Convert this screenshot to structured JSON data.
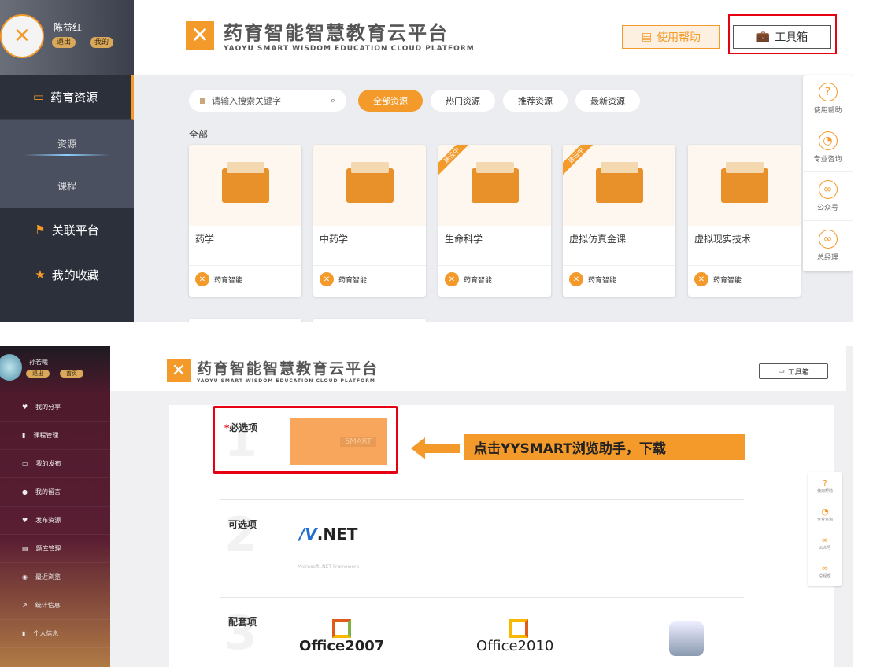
{
  "top": {
    "user": {
      "name": "陈益红",
      "logout": "退出",
      "mine": "我的"
    },
    "sidebar": [
      {
        "label": "药育资源"
      },
      {
        "label": "关联平台"
      },
      {
        "label": "我的收藏"
      }
    ],
    "sub": [
      "资源",
      "课程"
    ],
    "logo": {
      "title": "药育智能智慧教育云平台",
      "subtitle": "YAOYU SMART WISDOM EDUCATION CLOUD PLATFORM"
    },
    "help_btn": "使用帮助",
    "tool_btn": "工具箱",
    "search_placeholder": "请输入搜索关键字",
    "filters": [
      "全部资源",
      "热门资源",
      "推荐资源",
      "最新资源"
    ],
    "section": "全部",
    "cards": [
      {
        "name": "药学",
        "badge": ""
      },
      {
        "name": "中药学",
        "badge": ""
      },
      {
        "name": "生命科学",
        "badge": "建设中"
      },
      {
        "name": "虚拟仿真金课",
        "badge": "建设中"
      },
      {
        "name": "虚拟现实技术",
        "badge": ""
      }
    ],
    "card_owner": "药育智能",
    "float": [
      "使用帮助",
      "专业咨询",
      "公众号",
      "总经理"
    ]
  },
  "bottom": {
    "user": {
      "name": "孙若曦",
      "logout": "退出",
      "home": "首页"
    },
    "sidebar": [
      "我的分享",
      "课程管理",
      "我的发布",
      "我的留言",
      "发布资源",
      "题库管理",
      "最近浏览",
      "统计信息",
      "个人信息"
    ],
    "logo": {
      "title": "药育智能智慧教育云平台",
      "subtitle": "YAOYU SMART WISDOM EDUCATION CLOUD PLATFORM"
    },
    "tool_btn": "工具箱",
    "required": "必选项",
    "optional": "可选项",
    "bundled": "配套项",
    "smart_label": "SMART",
    "net_caption": "Microsoft .NET Framework",
    "net_logo": ".NET",
    "office2007": "Office2007",
    "office2010": "Office2010",
    "callout": "点击YYSMART浏览助手，下载",
    "float": [
      "使用帮助",
      "专业咨询",
      "公众号",
      "总经理"
    ],
    "nums": [
      "1",
      "2",
      "3"
    ]
  }
}
